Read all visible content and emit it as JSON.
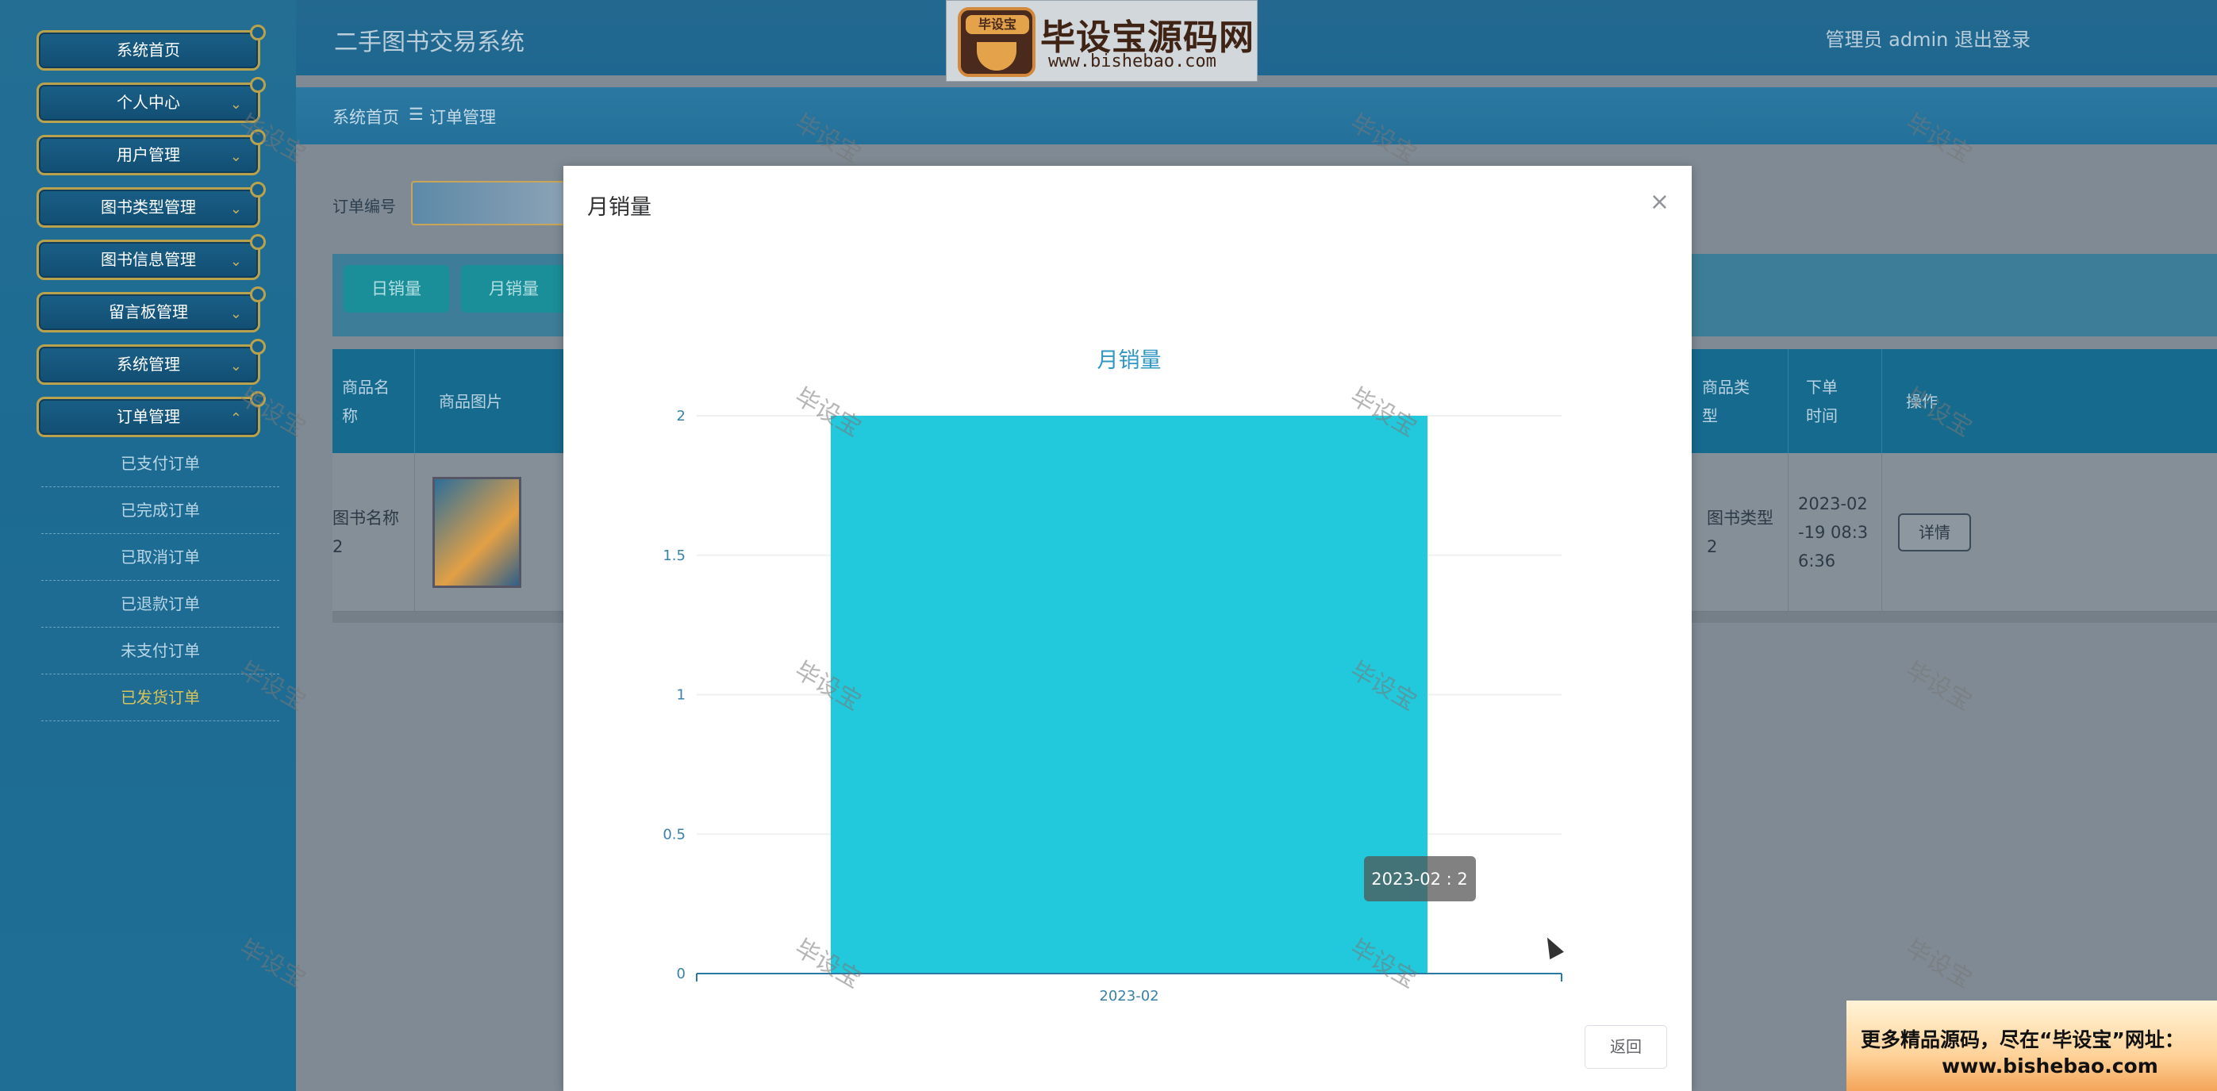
{
  "app": {
    "title": "二手图书交易系统",
    "user": "管理员 admin  退出登录"
  },
  "logo": {
    "badge": "毕设宝",
    "name": "毕设宝源码网",
    "url": "www.bishebao.com"
  },
  "breadcrumb": {
    "home": "系统首页",
    "sep": "☰",
    "current": "订单管理"
  },
  "sidebar": {
    "items": [
      {
        "label": "系统首页"
      },
      {
        "label": "个人中心"
      },
      {
        "label": "用户管理"
      },
      {
        "label": "图书类型管理"
      },
      {
        "label": "图书信息管理"
      },
      {
        "label": "留言板管理"
      },
      {
        "label": "系统管理"
      },
      {
        "label": "订单管理"
      }
    ],
    "sub_items": [
      {
        "label": "已支付订单"
      },
      {
        "label": "已完成订单"
      },
      {
        "label": "已取消订单"
      },
      {
        "label": "已退款订单"
      },
      {
        "label": "未支付订单"
      },
      {
        "label": "已发货订单"
      }
    ]
  },
  "search": {
    "label": "订单编号"
  },
  "toolbar": {
    "daily": "日销量",
    "monthly": "月销量"
  },
  "table": {
    "headers": [
      "商品名称",
      "商品图片",
      "商品类型",
      "下单时间",
      "操作"
    ],
    "row": {
      "name": "图书名称2",
      "type": "图书类型2",
      "time": "2023-02-19 08:36:36",
      "action": "详情"
    }
  },
  "modal": {
    "title": "月销量",
    "close": "×",
    "back": "返回"
  },
  "chart_data": {
    "type": "bar",
    "title": "月销量",
    "categories": [
      "2023-02"
    ],
    "values": [
      2
    ],
    "ylim": [
      0,
      2
    ],
    "yticks": [
      "0",
      "0.5",
      "1",
      "1.5",
      "2"
    ],
    "tooltip": "2023-02 : 2",
    "color": "#22c8dc",
    "grid": true
  },
  "watermark": "毕设宝",
  "ad": {
    "line1": "更多精品源码，尽在“毕设宝”网址：",
    "line2": "www.bishebao.com"
  }
}
